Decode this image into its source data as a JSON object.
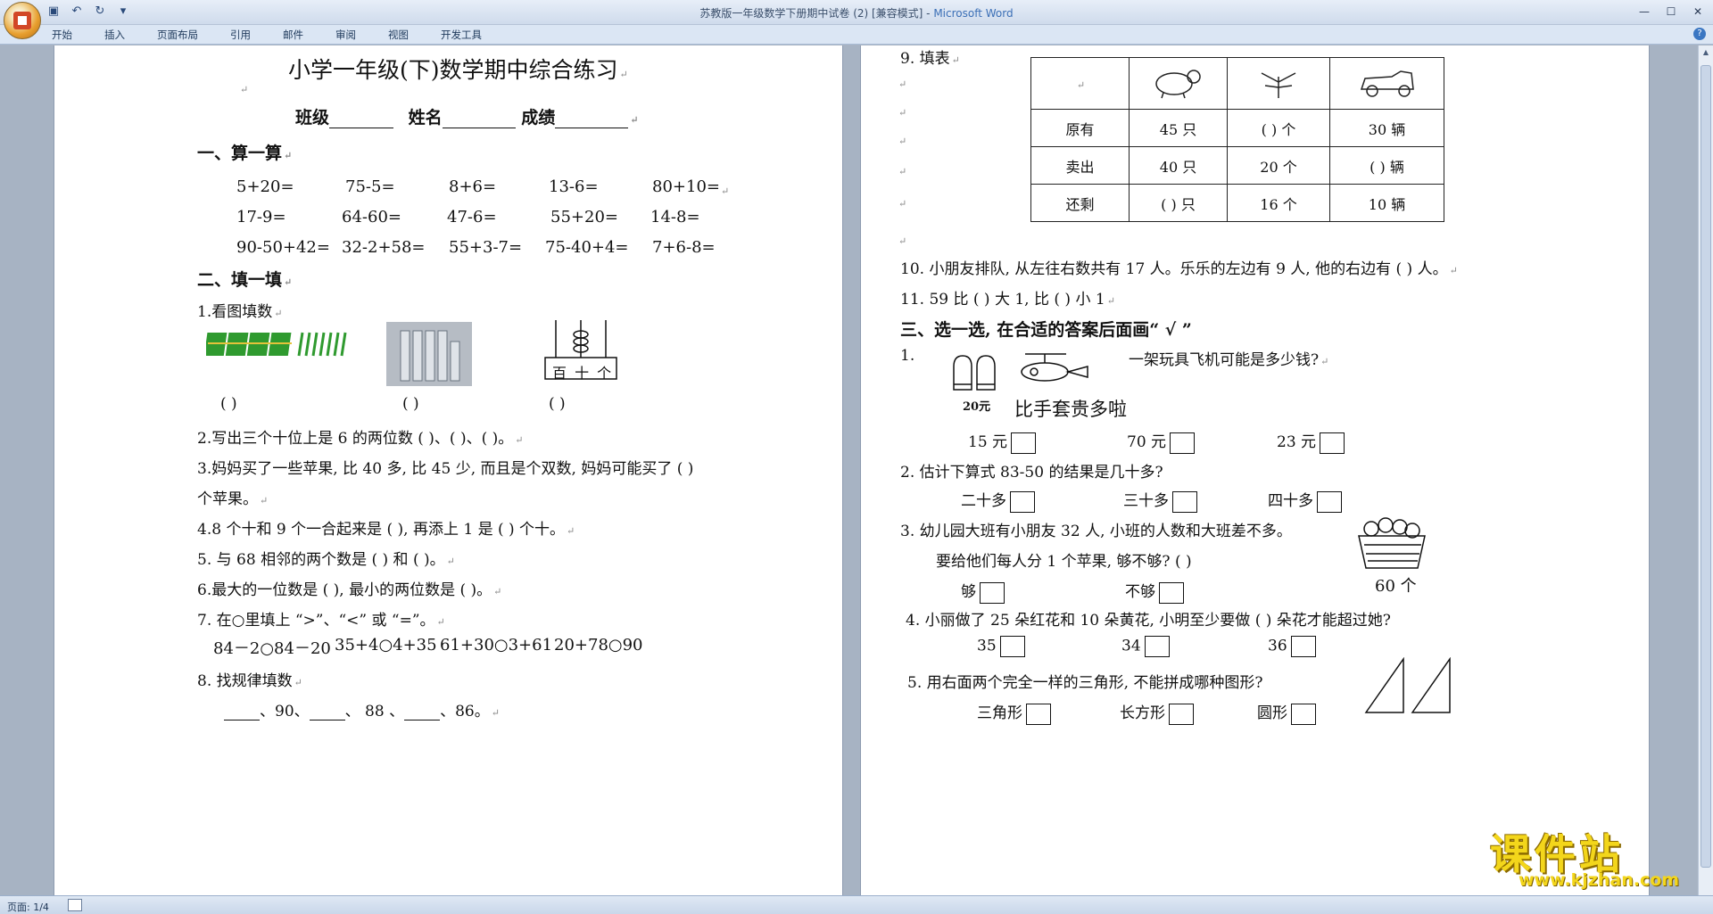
{
  "window": {
    "title_doc": "苏教版一年级数学下册期中试卷 (2) [兼容模式] - ",
    "title_app": "Microsoft Word"
  },
  "tabs": [
    "开始",
    "插入",
    "页面布局",
    "引用",
    "邮件",
    "审阅",
    "视图",
    "开发工具"
  ],
  "status": {
    "page": "页面: 1/4"
  },
  "watermark": {
    "cn": "课件站",
    "url": "www.kjzhan.com"
  },
  "left": {
    "title": "小学一年级(下)数学期中综合练习",
    "class_label": "班级",
    "name_label": "姓名",
    "score_label": "成绩",
    "sec1": "一、算一算",
    "calc_rows": [
      [
        "5+20=",
        "75-5=",
        "8+6=",
        "13-6=",
        "80+10="
      ],
      [
        "17-9=",
        "64-60=",
        "47-6=",
        "55+20=",
        "14-8="
      ],
      [
        "90-50+42=",
        "32-2+58=",
        "55+3-7=",
        "75-40+4=",
        "7+6-8="
      ]
    ],
    "sec2": "二、填一填",
    "q1": "1.看图填数",
    "abacus_label": "百 十 个",
    "paren": "(          )",
    "q2": "2.写出三个十位上是 6 的两位数 (    )、(    )、(    )。",
    "q3a": "3.妈妈买了一些苹果, 比 40 多, 比 45 少, 而且是个双数, 妈妈可能买了 (        )",
    "q3b": "个苹果。",
    "q4": "4.8 个十和 9 个一合起来是 (    ), 再添上 1 是 (    ) 个十。",
    "q5": "5. 与 68 相邻的两个数是 (      ) 和 (      )。",
    "q6": "6.最大的一位数是 (      ), 最小的两位数是 (      )。",
    "q7": "7. 在○里填上 “>”、“<” 或 “=”。",
    "compare": [
      "84－2○84－20",
      "35+4○4+35",
      "61+30○3+61",
      "20+78○90"
    ],
    "q8": "8. 找规律填数",
    "q8_parts": [
      "、90、",
      "、 88 、",
      "、86。"
    ]
  },
  "right": {
    "q9": "9. 填表",
    "table": {
      "rows": [
        [
          "原有",
          "45 只",
          "(    ) 个",
          "30 辆"
        ],
        [
          "卖出",
          "40 只",
          "20 个",
          "(    ) 辆"
        ],
        [
          "还剩",
          "(    ) 只",
          "16 个",
          "10 辆"
        ]
      ]
    },
    "q10": "10. 小朋友排队, 从左往右数共有 17 人。乐乐的左边有 9 人, 他的右边有 (    ) 人。",
    "q11": "11. 59 比 (      ) 大 1, 比 (      ) 小 1",
    "sec3": "三、选一选, 在合适的答案后面画“ √ ”",
    "s1_num": "1.",
    "s1_q": "一架玩具飞机可能是多少钱?",
    "s1_price": "20元",
    "s1_hint": "比手套贵多啦",
    "s1_opts": [
      "15 元",
      "70 元",
      "23 元"
    ],
    "s2_q": "2. 估计下算式 83-50 的结果是几十多?",
    "s2_opts": [
      "二十多",
      "三十多",
      "四十多"
    ],
    "s3_q": "3. 幼儿园大班有小朋友 32 人, 小班的人数和大班差不多。",
    "s3_q2": "要给他们每人分 1 个苹果, 够不够? (      )",
    "s3_opts": [
      "够",
      "不够"
    ],
    "s3_basket": "60 个",
    "s4_q": "4. 小丽做了 25 朵红花和 10 朵黄花, 小明至少要做 (    ) 朵花才能超过她?",
    "s4_opts": [
      "35",
      "34",
      "36"
    ],
    "s5_q": "5. 用右面两个完全一样的三角形, 不能拼成哪种图形?",
    "s5_opts": [
      "三角形",
      "长方形",
      "圆形"
    ]
  }
}
